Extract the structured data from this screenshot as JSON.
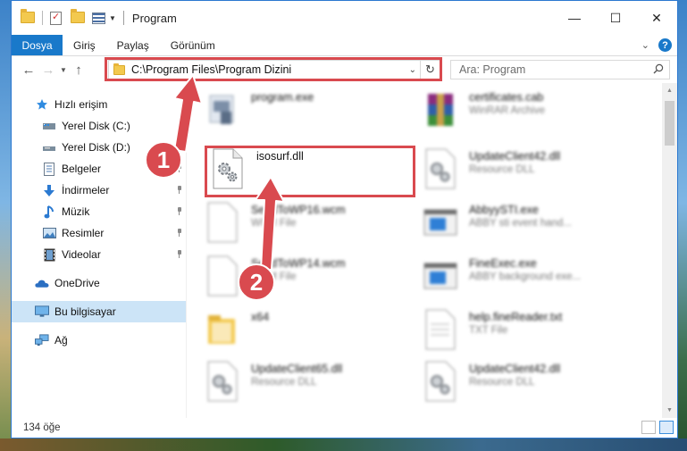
{
  "window": {
    "title": "Program",
    "controls": {
      "minimize": "—",
      "maximize": "☐",
      "close": "✕"
    }
  },
  "ribbon": {
    "file_tab": "Dosya",
    "tabs": [
      "Giriş",
      "Paylaş",
      "Görünüm"
    ],
    "help": "?"
  },
  "navbar": {
    "back": "←",
    "forward": "→",
    "recent": "⌄",
    "up": "↑",
    "address": "C:\\Program Files\\Program Dizini",
    "address_dropdown": "⌄",
    "refresh": "↻",
    "search_placeholder": "Ara: Program"
  },
  "sidebar": {
    "items": [
      {
        "label": "Hızlı erişim",
        "icon": "star-icon",
        "pinned": false
      },
      {
        "label": "Yerel Disk (C:)",
        "icon": "drive-icon",
        "pinned": false
      },
      {
        "label": "Yerel Disk (D:)",
        "icon": "drive-icon",
        "pinned": false
      },
      {
        "label": "Belgeler",
        "icon": "documents-icon",
        "pinned": true
      },
      {
        "label": "İndirmeler",
        "icon": "download-icon",
        "pinned": true
      },
      {
        "label": "Müzik",
        "icon": "music-icon",
        "pinned": true
      },
      {
        "label": "Resimler",
        "icon": "pictures-icon",
        "pinned": true
      },
      {
        "label": "Videolar",
        "icon": "videos-icon",
        "pinned": true
      },
      {
        "label": "OneDrive",
        "icon": "onedrive-icon",
        "pinned": false
      },
      {
        "label": "Bu bilgisayar",
        "icon": "computer-icon",
        "pinned": false,
        "selected": true
      },
      {
        "label": "Ağ",
        "icon": "network-icon",
        "pinned": false
      }
    ]
  },
  "files": [
    {
      "name": "program.exe",
      "type": "",
      "icon": "program-icon",
      "blurred": true
    },
    {
      "name": "certificates.cab",
      "type": "WinRAR Archive",
      "icon": "winrar-icon",
      "blurred": true
    },
    {
      "name": "isosurf.dll",
      "type": "",
      "icon": "dll-gear-icon",
      "blurred": false
    },
    {
      "name": "UpdateClient42.dll",
      "type": "Resource DLL",
      "icon": "dll-gear-icon",
      "blurred": true
    },
    {
      "name": "SendToWP16.wcm",
      "type": "WCM File",
      "icon": "blank-file-icon",
      "blurred": true
    },
    {
      "name": "AbbyySTI.exe",
      "type": "ABBY sti event hand...",
      "icon": "app-window-icon",
      "blurred": true
    },
    {
      "name": "SendToWP14.wcm",
      "type": "WCM File",
      "icon": "blank-file-icon",
      "blurred": true
    },
    {
      "name": "FineExec.exe",
      "type": "ABBY background exe...",
      "icon": "app-window-icon",
      "blurred": true
    },
    {
      "name": "x64",
      "type": "",
      "icon": "folder-icon",
      "blurred": true
    },
    {
      "name": "help.fineReader.txt",
      "type": "TXT File",
      "icon": "text-file-icon",
      "blurred": true
    },
    {
      "name": "UpdateClient65.dll",
      "type": "Resource DLL",
      "icon": "dll-gear-icon",
      "blurred": true
    },
    {
      "name": "UpdateClient42.dll",
      "type": "Resource DLL",
      "icon": "dll-gear-icon",
      "blurred": true
    }
  ],
  "status": {
    "item_count": "134 öğe"
  },
  "annotations": {
    "step1": "1",
    "step2": "2",
    "color": "#d94a4f"
  }
}
